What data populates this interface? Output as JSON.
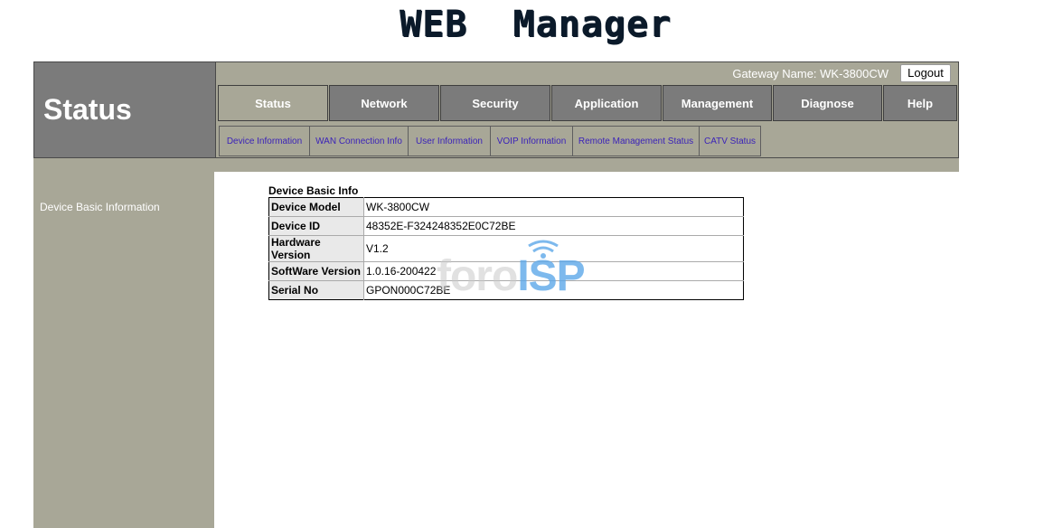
{
  "brand": {
    "title": "WEB  Manager"
  },
  "header": {
    "section_title": "Status",
    "gateway_label": "Gateway Name: WK-3800CW",
    "logout_label": "Logout"
  },
  "main_nav": [
    {
      "label": "Status",
      "active": true
    },
    {
      "label": "Network"
    },
    {
      "label": "Security"
    },
    {
      "label": "Application"
    },
    {
      "label": "Management"
    },
    {
      "label": "Diagnose"
    },
    {
      "label": "Help"
    }
  ],
  "sub_nav": [
    {
      "label": "Device Information"
    },
    {
      "label": "WAN Connection Info"
    },
    {
      "label": "User Information"
    },
    {
      "label": "VOIP Information"
    },
    {
      "label": "Remote Management Status"
    },
    {
      "label": "CATV Status"
    }
  ],
  "sidebar": {
    "items": [
      {
        "label": "Device Basic Information"
      }
    ]
  },
  "device_info": {
    "title": "Device Basic Info",
    "rows": [
      {
        "label": "Device Model",
        "value": "WK-3800CW"
      },
      {
        "label": "Device ID",
        "value": "48352E-F324248352E0C72BE"
      },
      {
        "label": "Hardware Version",
        "value": "V1.2"
      },
      {
        "label": "SoftWare Version",
        "value": "1.0.16-200422"
      },
      {
        "label": "Serial No",
        "value": "GPON000C72BE"
      }
    ]
  },
  "watermark": {
    "part_a": "foro",
    "part_b": "ISP"
  },
  "colors": {
    "chrome": "#a8a797",
    "tab": "#7b7b7b",
    "link": "#3b23b8"
  }
}
